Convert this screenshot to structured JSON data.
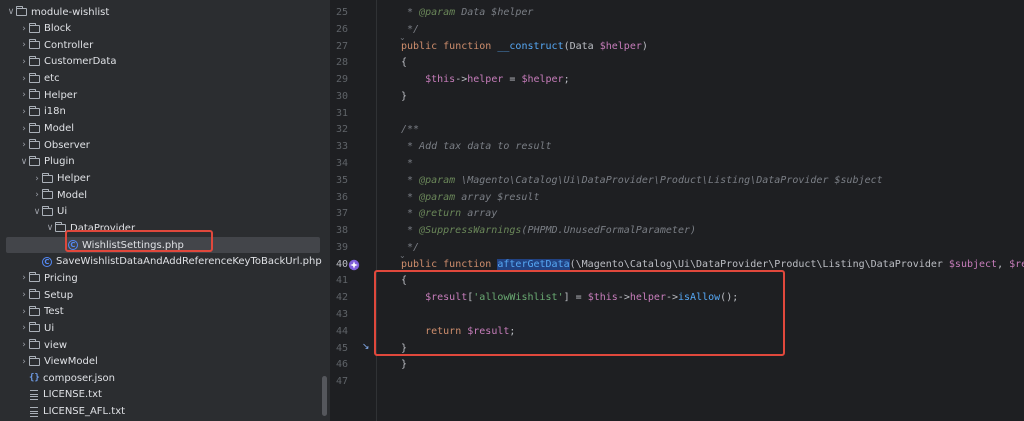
{
  "tree": {
    "items": [
      {
        "label": "module-wishlist",
        "type": "folder",
        "chevron": "∨"
      },
      {
        "label": "Block",
        "type": "folder",
        "chevron": "›"
      },
      {
        "label": "Controller",
        "type": "folder",
        "chevron": "›"
      },
      {
        "label": "CustomerData",
        "type": "folder",
        "chevron": "›"
      },
      {
        "label": "etc",
        "type": "folder",
        "chevron": "›"
      },
      {
        "label": "Helper",
        "type": "folder",
        "chevron": "›"
      },
      {
        "label": "i18n",
        "type": "folder",
        "chevron": "›"
      },
      {
        "label": "Model",
        "type": "folder",
        "chevron": "›"
      },
      {
        "label": "Observer",
        "type": "folder",
        "chevron": "›"
      },
      {
        "label": "Plugin",
        "type": "folder",
        "chevron": "∨"
      },
      {
        "label": "Helper",
        "type": "folder",
        "chevron": "›"
      },
      {
        "label": "Model",
        "type": "folder",
        "chevron": "›"
      },
      {
        "label": "Ui",
        "type": "folder",
        "chevron": "∨"
      },
      {
        "label": "DataProvider",
        "type": "folder",
        "chevron": "∨"
      },
      {
        "label": "WishlistSettings.php",
        "type": "class",
        "chevron": ""
      },
      {
        "label": "SaveWishlistDataAndAddReferenceKeyToBackUrl.php",
        "type": "class",
        "chevron": ""
      },
      {
        "label": "Pricing",
        "type": "folder",
        "chevron": "›"
      },
      {
        "label": "Setup",
        "type": "folder",
        "chevron": "›"
      },
      {
        "label": "Test",
        "type": "folder",
        "chevron": "›"
      },
      {
        "label": "Ui",
        "type": "folder",
        "chevron": "›"
      },
      {
        "label": "view",
        "type": "folder",
        "chevron": "›"
      },
      {
        "label": "ViewModel",
        "type": "folder",
        "chevron": "›"
      },
      {
        "label": "composer.json",
        "type": "json",
        "chevron": ""
      },
      {
        "label": "LICENSE.txt",
        "type": "text",
        "chevron": ""
      },
      {
        "label": "LICENSE_AFL.txt",
        "type": "text",
        "chevron": ""
      }
    ]
  },
  "editor": {
    "lines": [
      {
        "n": "25",
        "code": " * @param Data $helper"
      },
      {
        "n": "26",
        "code": " */"
      },
      {
        "n": "27",
        "code": "public function __construct(Data $helper)"
      },
      {
        "n": "28",
        "code": "{"
      },
      {
        "n": "29",
        "code": "    $this->helper = $helper;"
      },
      {
        "n": "30",
        "code": "}"
      },
      {
        "n": "31",
        "code": ""
      },
      {
        "n": "32",
        "code": "/**"
      },
      {
        "n": "33",
        "code": " * Add tax data to result"
      },
      {
        "n": "34",
        "code": " *"
      },
      {
        "n": "35",
        "code": " * @param \\Magento\\Catalog\\Ui\\DataProvider\\Product\\Listing\\DataProvider $subject"
      },
      {
        "n": "36",
        "code": " * @param array $result"
      },
      {
        "n": "37",
        "code": " * @return array"
      },
      {
        "n": "38",
        "code": " * @SuppressWarnings(PHPMD.UnusedFormalParameter)"
      },
      {
        "n": "39",
        "code": " */"
      },
      {
        "n": "40",
        "code": "public function afterGetData(\\Magento\\Catalog\\Ui\\DataProvider\\Product\\Listing\\DataProvider $subject, $result)"
      },
      {
        "n": "41",
        "code": "{"
      },
      {
        "n": "42",
        "code": "    $result['allowWishlist'] = $this->helper->isAllow();"
      },
      {
        "n": "43",
        "code": ""
      },
      {
        "n": "44",
        "code": "    return $result;"
      },
      {
        "n": "45",
        "code": "}"
      },
      {
        "n": "46",
        "code": "}"
      },
      {
        "n": "47",
        "code": ""
      }
    ]
  },
  "colors": {
    "highlight": "#e0483c",
    "accent": "#548af7"
  },
  "icons": [
    "folder-icon",
    "php-class-icon",
    "json-icon",
    "text-file-icon",
    "override-gutter-icon"
  ]
}
